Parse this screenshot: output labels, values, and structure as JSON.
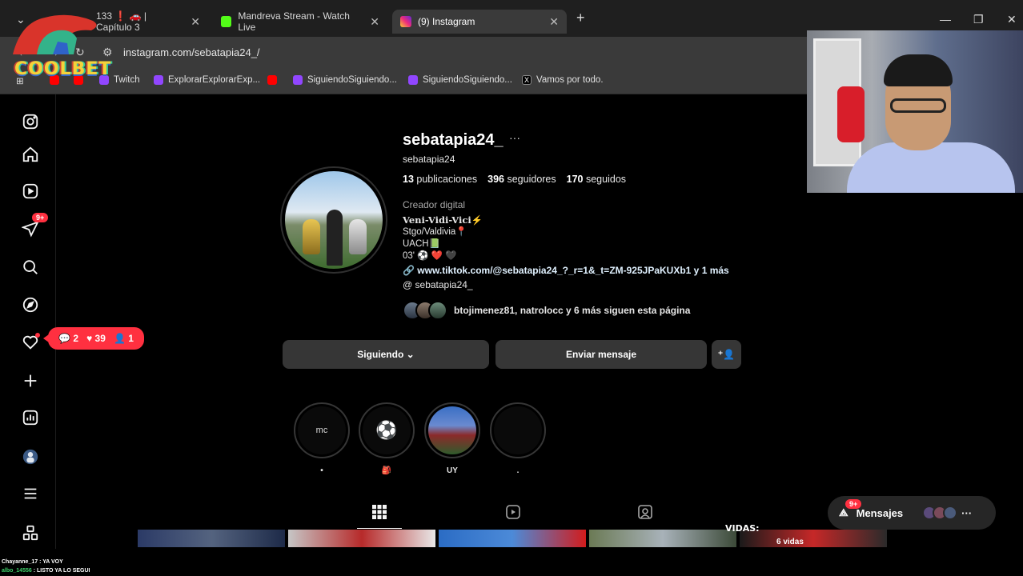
{
  "browser": {
    "tabs": [
      {
        "label": "133 ❗ 🚗 | Capítulo 3",
        "active": false
      },
      {
        "label": "Mandreva Stream - Watch Live",
        "active": false
      },
      {
        "label": "(9) Instagram",
        "active": true
      }
    ],
    "url": "instagram.com/sebatapia24_/",
    "bookmarks": [
      "Twitch",
      "ExplorarExplorarExp...",
      "SiguiendoSiguiendo...",
      "SiguiendoSiguiendo...",
      "Vamos por todo."
    ],
    "colors": {
      "tab_active": "#3a3a3a",
      "kick_green": "#53fc18",
      "twitch_purple": "#9146ff",
      "youtube_red": "#ff0000"
    }
  },
  "overlay": {
    "logo_text": "COOLBET",
    "chat": [
      {
        "user": "Chayanne_17",
        "message": "YA VOY"
      },
      {
        "user": "albo_14556",
        "message": "LISTO YA LO SEGUI"
      }
    ]
  },
  "sidebar": {
    "icons": [
      "instagram-logo-icon",
      "home-icon",
      "reels-icon",
      "direct-icon",
      "search-icon",
      "explore-icon",
      "notifications-icon",
      "create-icon",
      "dashboard-icon",
      "profile-icon",
      "menu-icon",
      "also-from-meta-icon"
    ],
    "direct_badge": "9+",
    "notifications": {
      "comments": "2",
      "likes": "39",
      "follows": "1"
    }
  },
  "profile": {
    "username": "sebatapia24_",
    "more": "···",
    "handle": "sebatapia24",
    "stats": {
      "posts": "13",
      "posts_label": "publicaciones",
      "followers": "396",
      "followers_label": "seguidores",
      "following": "170",
      "following_label": "seguidos"
    },
    "category": "Creador digital",
    "bio": [
      "Veni-Vidi-Vici⚡",
      "Stgo/Valdivia📍",
      "UACH📗",
      "03' ⚽ ❤️ 🖤"
    ],
    "link": "www.tiktok.com/@sebatapia24_?_r=1&_t=ZM-925JPaKUXb1 y 1 más",
    "threads": "sebatapia24_",
    "followed_by": "btojimenez81, natrolocc y 6 más siguen esta página",
    "buttons": {
      "following": "Siguiendo",
      "message": "Enviar mensaje"
    },
    "highlights": [
      {
        "inner": "mc",
        "label": "•"
      },
      {
        "inner": "⚽",
        "label": "🎒"
      },
      {
        "inner": "",
        "label": "UY"
      },
      {
        "inner": "",
        "label": "."
      }
    ],
    "grid_text": {
      "vidas": "VIDAS:",
      "vidas_count": "6 vidas"
    }
  },
  "messages": {
    "label": "Mensajes",
    "badge": "9+"
  }
}
